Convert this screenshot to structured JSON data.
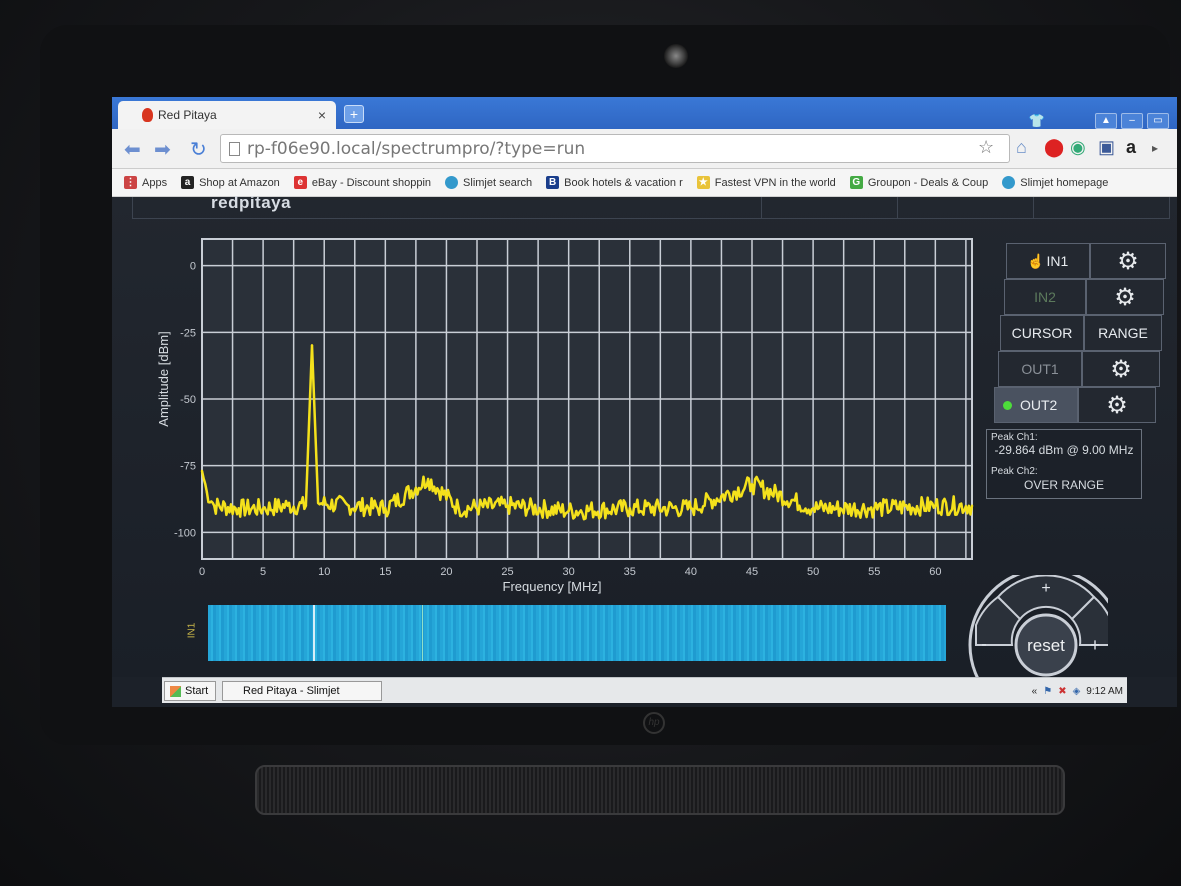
{
  "browser": {
    "tab_title": "Red Pitaya",
    "tab_close": "×",
    "new_tab": "+",
    "url": "rp-f06e90.local/spectrumpro/?type=run",
    "bookmarks": [
      {
        "label": "Apps",
        "icon": "apps-icon"
      },
      {
        "label": "Shop at Amazon",
        "icon": "amazon-icon"
      },
      {
        "label": "eBay - Discount shoppin",
        "icon": "ebay-icon"
      },
      {
        "label": "Slimjet search",
        "icon": "globe-icon"
      },
      {
        "label": "Book hotels & vacation r",
        "icon": "booking-icon"
      },
      {
        "label": "Fastest VPN in the world",
        "icon": "vpn-icon"
      },
      {
        "label": "Groupon - Deals & Coup",
        "icon": "groupon-icon"
      },
      {
        "label": "Slimjet homepage",
        "icon": "globe-icon"
      }
    ]
  },
  "app": {
    "logo": "redpitaya",
    "controls": {
      "in1": "IN1",
      "in2": "IN2",
      "cursor": "CURSOR",
      "range": "RANGE",
      "out1": "OUT1",
      "out2": "OUT2"
    },
    "peaks": {
      "ch1_label": "Peak Ch1:",
      "ch1_value": "-29.864 dBm @ 9.00 MHz",
      "ch2_label": "Peak Ch2:",
      "ch2_value": "OVER RANGE"
    },
    "waterfall_label": "IN1",
    "dpad": {
      "reset": "reset",
      "plus": "+",
      "minus": "-"
    }
  },
  "chart_data": {
    "type": "line",
    "xlabel": "Frequency [MHz]",
    "ylabel": "Amplitude [dBm]",
    "xlim": [
      0,
      63
    ],
    "ylim": [
      -110,
      10
    ],
    "x_ticks": [
      0,
      5,
      10,
      15,
      20,
      25,
      30,
      35,
      40,
      45,
      50,
      55,
      60
    ],
    "y_ticks": [
      0,
      -25,
      -50,
      -75,
      -100
    ],
    "grid": true,
    "series": [
      {
        "color": "#f4e11c",
        "x": [
          0,
          0.4,
          1,
          3,
          5,
          7,
          8.5,
          9.0,
          9.5,
          12,
          15,
          18.5,
          21,
          25,
          30,
          35,
          40,
          45,
          50,
          55,
          60,
          63
        ],
        "y": [
          -77,
          -85,
          -90,
          -91,
          -91,
          -90,
          -90,
          -29.9,
          -89,
          -90,
          -91,
          -80,
          -91,
          -90,
          -92,
          -91,
          -91,
          -82,
          -91,
          -91,
          -90,
          -90
        ]
      }
    ]
  },
  "taskbar": {
    "start": "Start",
    "window": "Red Pitaya - Slimjet",
    "time": "9:12 AM"
  },
  "colors": {
    "trace": "#f4e11c",
    "grid": "#c9ced6",
    "plot_bg": "#2a3039",
    "waterfall": "#26a8da"
  }
}
